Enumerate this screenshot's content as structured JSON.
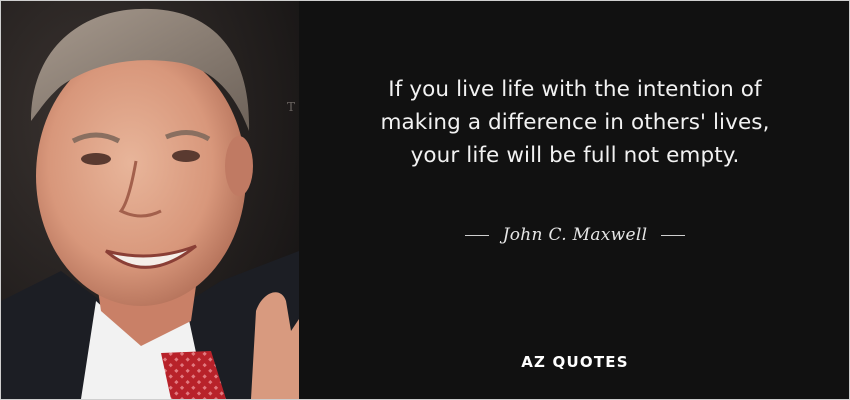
{
  "quote": {
    "lines": [
      "If you live life with the intention of",
      "making a difference in others' lives,",
      "your life will be full not empty."
    ]
  },
  "author": "John C. Maxwell",
  "brand": "AZ QUOTES",
  "colors": {
    "background": "#111111",
    "text": "#f2f2f2",
    "tie": "#b8222a"
  }
}
